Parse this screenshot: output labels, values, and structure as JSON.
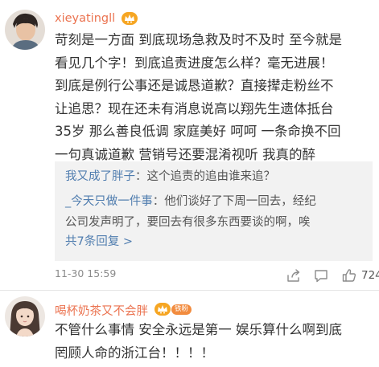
{
  "comments": [
    {
      "username": "xieyatingll",
      "body_lines": [
        "苛刻是一方面 到底现场急救及时不及时 至今就是",
        "看见几个字！到底追责进度怎么样？毫无进展！",
        "到底是例行公事还是诚恳道歉？直接撵走粉丝不",
        "让追思？现在还未有消息说高以翔先生遗体抵台",
        "35岁 那么善良低调 家庭美好 呵呵 一条命换不回",
        "一句真诚道歉 营销号还要混淆视听 我真的醉"
      ],
      "replies": [
        {
          "nick": "我又成了胖子",
          "lines": [
            "：这个追责的追由谁来追？"
          ]
        },
        {
          "nick": "_今天只做一件事",
          "lines": [
            "：他们谈好了下周一回去，经纪",
            "公司发声明了，要回去有很多东西要谈的啊，唉"
          ]
        }
      ],
      "more_replies": "共7条回复 >",
      "time": "11-30 15:59",
      "likes": "724"
    },
    {
      "username": "喝杯奶茶又不会胖",
      "fan_tag": "铁粉",
      "body_lines": [
        "不管什么事情 安全永远是第一 娱乐算什么啊到底",
        "罔顾人命的浙江台！！！！"
      ]
    }
  ],
  "colors": {
    "username": "#eb7350",
    "link": "#507daf",
    "vip_badge": "#f6a623",
    "reply_bg": "#f2f2f2"
  },
  "icons": [
    "vip-crown-icon",
    "share-icon",
    "comment-icon",
    "like-icon"
  ]
}
